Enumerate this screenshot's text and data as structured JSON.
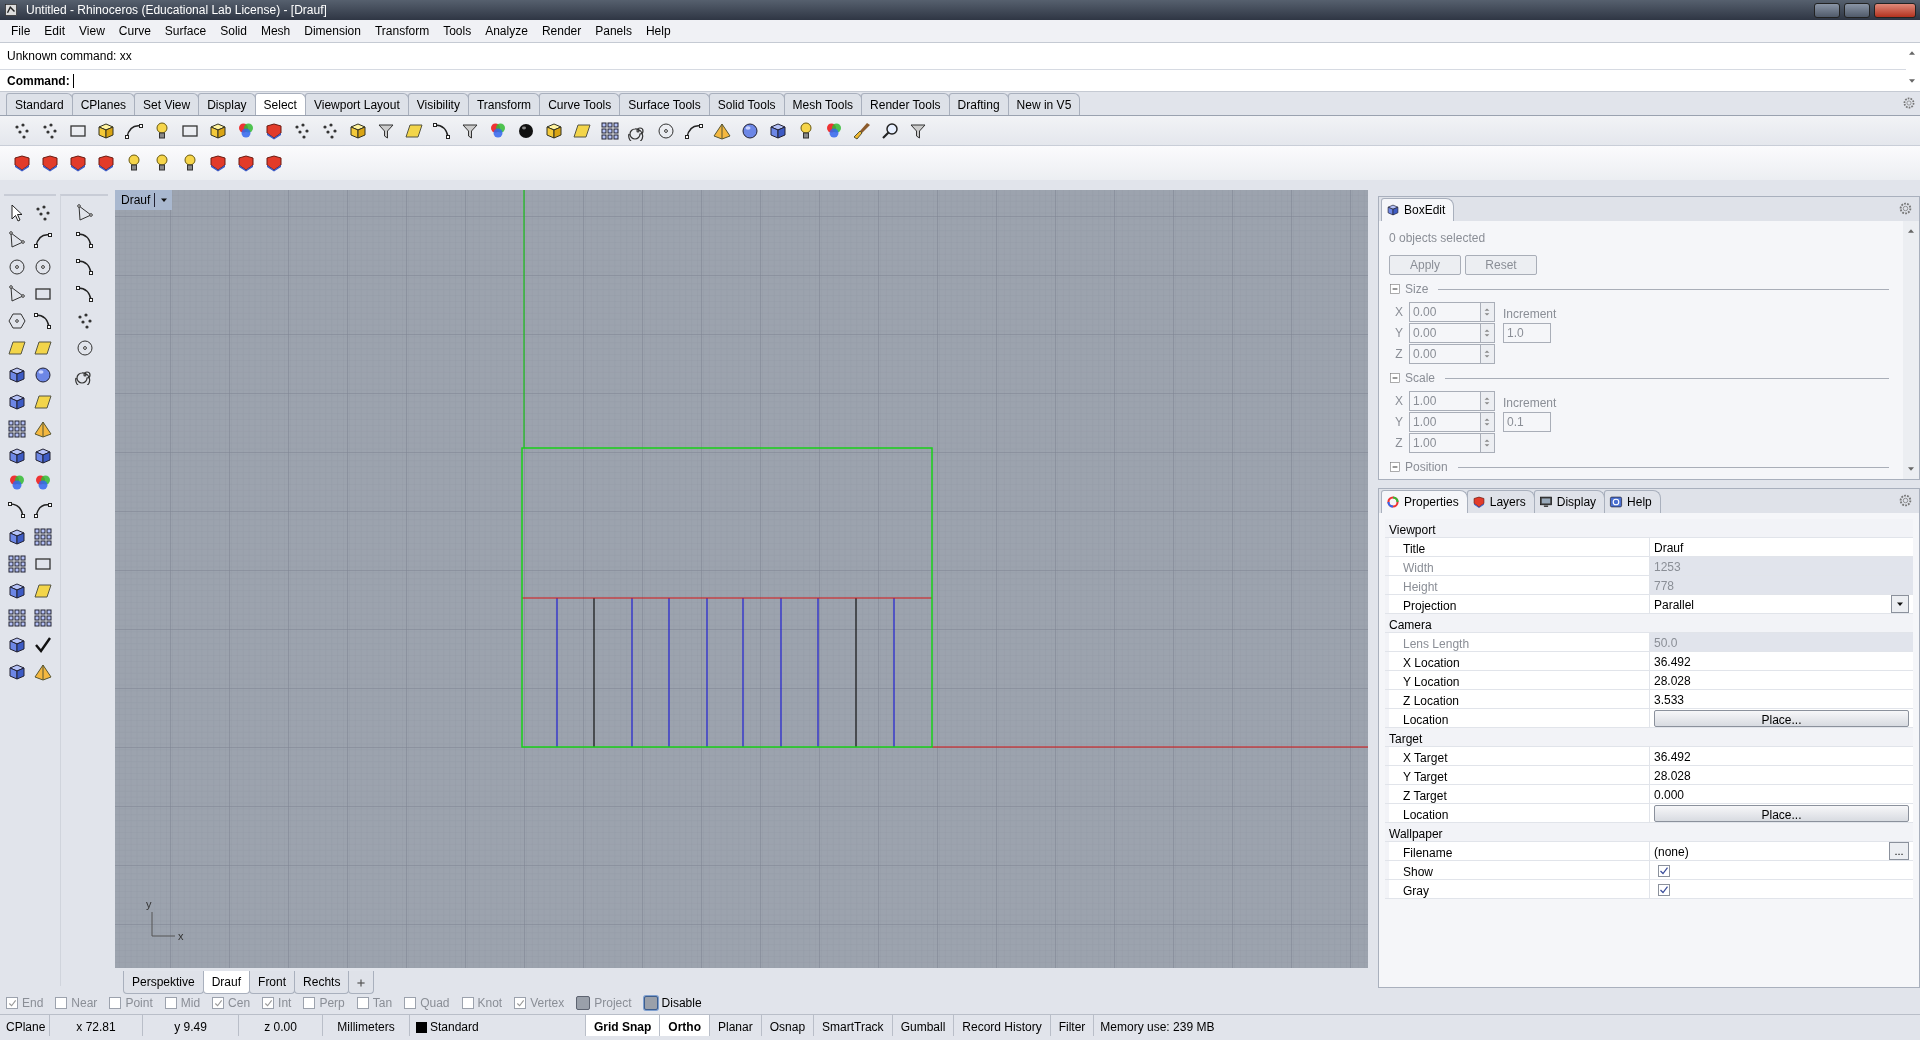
{
  "window": {
    "title": "Untitled - Rhinoceros (Educational Lab License) - [Drauf]"
  },
  "menu": [
    "File",
    "Edit",
    "View",
    "Curve",
    "Surface",
    "Solid",
    "Mesh",
    "Dimension",
    "Transform",
    "Tools",
    "Analyze",
    "Render",
    "Panels",
    "Help"
  ],
  "command_history": [
    "Unknown command: xx"
  ],
  "command_prompt": {
    "label": "Command:"
  },
  "toolbar_tabs": [
    {
      "label": "Standard",
      "selected": false
    },
    {
      "label": "CPlanes",
      "selected": false
    },
    {
      "label": "Set View",
      "selected": false
    },
    {
      "label": "Display",
      "selected": false
    },
    {
      "label": "Select",
      "selected": true
    },
    {
      "label": "Viewport Layout",
      "selected": false
    },
    {
      "label": "Visibility",
      "selected": false
    },
    {
      "label": "Transform",
      "selected": false
    },
    {
      "label": "Curve Tools",
      "selected": false
    },
    {
      "label": "Surface Tools",
      "selected": false
    },
    {
      "label": "Solid Tools",
      "selected": false
    },
    {
      "label": "Mesh Tools",
      "selected": false
    },
    {
      "label": "Render Tools",
      "selected": false
    },
    {
      "label": "Drafting",
      "selected": false
    },
    {
      "label": "New in V5",
      "selected": false
    }
  ],
  "viewport": {
    "title": "Drauf",
    "axis_labels": [
      "y",
      "x"
    ]
  },
  "viewport_tabs": [
    {
      "label": "Perspektive",
      "selected": false
    },
    {
      "label": "Drauf",
      "selected": true
    },
    {
      "label": "Front",
      "selected": false
    },
    {
      "label": "Rechts",
      "selected": false
    }
  ],
  "boxedit": {
    "title": "BoxEdit",
    "status": "0 objects selected",
    "disabled": true,
    "buttons": [
      "Apply",
      "Reset"
    ],
    "sections": [
      {
        "title": "Size",
        "expanded": true,
        "fields": [
          {
            "axis": "X",
            "value": "0.00"
          },
          {
            "axis": "Y",
            "value": "0.00"
          },
          {
            "axis": "Z",
            "value": "0.00"
          }
        ],
        "increment_label": "Increment",
        "increment": "1.0"
      },
      {
        "title": "Scale",
        "expanded": true,
        "fields": [
          {
            "axis": "X",
            "value": "1.00"
          },
          {
            "axis": "Y",
            "value": "1.00"
          },
          {
            "axis": "Z",
            "value": "1.00"
          }
        ],
        "increment_label": "Increment",
        "increment": "0.1"
      },
      {
        "title": "Position",
        "expanded": true
      }
    ]
  },
  "panel_tabs": [
    {
      "label": "Properties",
      "selected": true
    },
    {
      "label": "Layers",
      "selected": false
    },
    {
      "label": "Display",
      "selected": false
    },
    {
      "label": "Help",
      "selected": false
    }
  ],
  "properties": [
    {
      "title": "Viewport",
      "rows": [
        {
          "label": "Title",
          "kind": "text",
          "value": "Drauf",
          "disabled": false
        },
        {
          "label": "Width",
          "kind": "text",
          "value": "1253",
          "disabled": true
        },
        {
          "label": "Height",
          "kind": "text",
          "value": "778",
          "disabled": true
        },
        {
          "label": "Projection",
          "kind": "dropdown",
          "value": "Parallel",
          "disabled": false
        }
      ]
    },
    {
      "title": "Camera",
      "rows": [
        {
          "label": "Lens Length",
          "kind": "text",
          "value": "50.0",
          "disabled": true
        },
        {
          "label": "X Location",
          "kind": "text",
          "value": "36.492",
          "disabled": false
        },
        {
          "label": "Y Location",
          "kind": "text",
          "value": "28.028",
          "disabled": false
        },
        {
          "label": "Z Location",
          "kind": "text",
          "value": "3.533",
          "disabled": false
        },
        {
          "label": "Location",
          "kind": "button",
          "value": "Place...",
          "disabled": false
        }
      ]
    },
    {
      "title": "Target",
      "rows": [
        {
          "label": "X Target",
          "kind": "text",
          "value": "36.492",
          "disabled": false
        },
        {
          "label": "Y Target",
          "kind": "text",
          "value": "28.028",
          "disabled": false
        },
        {
          "label": "Z Target",
          "kind": "text",
          "value": "0.000",
          "disabled": false
        },
        {
          "label": "Location",
          "kind": "button",
          "value": "Place...",
          "disabled": false
        }
      ]
    },
    {
      "title": "Wallpaper",
      "rows": [
        {
          "label": "Filename",
          "kind": "file",
          "value": "(none)",
          "button": "...",
          "disabled": false
        },
        {
          "label": "Show",
          "kind": "checkbox",
          "checked": true,
          "disabled": false
        },
        {
          "label": "Gray",
          "kind": "checkbox",
          "checked": true,
          "disabled": false
        }
      ]
    }
  ],
  "osnaps": [
    {
      "label": "End",
      "kind": "check",
      "checked": true
    },
    {
      "label": "Near",
      "kind": "check",
      "checked": false
    },
    {
      "label": "Point",
      "kind": "check",
      "checked": false
    },
    {
      "label": "Mid",
      "kind": "check",
      "checked": false
    },
    {
      "label": "Cen",
      "kind": "check",
      "checked": true
    },
    {
      "label": "Int",
      "kind": "check",
      "checked": true
    },
    {
      "label": "Perp",
      "kind": "check",
      "checked": false
    },
    {
      "label": "Tan",
      "kind": "check",
      "checked": false
    },
    {
      "label": "Quad",
      "kind": "check",
      "checked": false
    },
    {
      "label": "Knot",
      "kind": "check",
      "checked": false
    },
    {
      "label": "Vertex",
      "kind": "check",
      "checked": true
    },
    {
      "label": "Project",
      "kind": "toggle",
      "checked": false
    },
    {
      "label": "Disable",
      "kind": "toggle",
      "checked": true
    }
  ],
  "status_bar": {
    "cells": [
      {
        "text": "CPlane",
        "kind": "text"
      },
      {
        "text": "x 72.81",
        "kind": "text"
      },
      {
        "text": "y 9.49",
        "kind": "text"
      },
      {
        "text": "z 0.00",
        "kind": "text"
      },
      {
        "text": "Millimeters",
        "kind": "text"
      },
      {
        "text": "Standard",
        "kind": "layer",
        "color": "#000000"
      }
    ],
    "toggles": [
      {
        "label": "Grid Snap",
        "on": true
      },
      {
        "label": "Ortho",
        "on": true
      },
      {
        "label": "Planar",
        "on": false
      },
      {
        "label": "Osnap",
        "on": false
      },
      {
        "label": "SmartTrack",
        "on": false
      },
      {
        "label": "Gumball",
        "on": false
      },
      {
        "label": "Record History",
        "on": false
      },
      {
        "label": "Filter",
        "on": false
      }
    ],
    "memory": "Memory use: 239 MB"
  }
}
